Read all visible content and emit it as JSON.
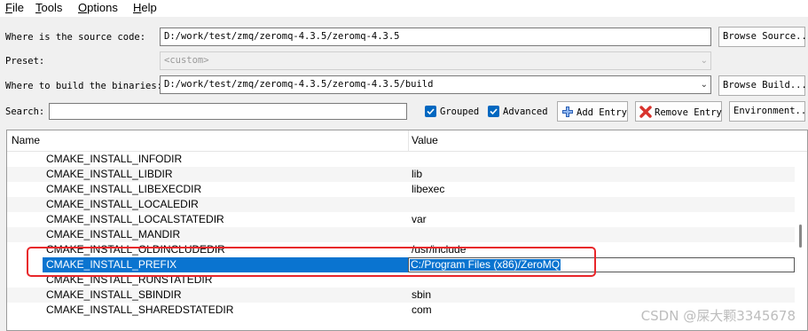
{
  "menubar": {
    "items": [
      {
        "label": "File",
        "mnemonic": "F",
        "rest": "ile"
      },
      {
        "label": "Tools",
        "mnemonic": "T",
        "rest": "ools"
      },
      {
        "label": "Options",
        "mnemonic": "O",
        "rest": "ptions"
      },
      {
        "label": "Help",
        "mnemonic": "H",
        "rest": "elp"
      }
    ]
  },
  "source": {
    "label": "Where is the source code:",
    "value": "D:/work/test/zmq/zeromq-4.3.5/zeromq-4.3.5",
    "browse_label": "Browse Source..."
  },
  "preset": {
    "label": "Preset:",
    "value": "<custom>"
  },
  "build": {
    "label": "Where to build the binaries:",
    "value": "D:/work/test/zmq/zeromq-4.3.5/zeromq-4.3.5/build",
    "browse_label": "Browse Build..."
  },
  "search": {
    "label": "Search:",
    "value": ""
  },
  "options": {
    "grouped_label": "Grouped",
    "grouped_checked": true,
    "advanced_label": "Advanced",
    "advanced_checked": true
  },
  "toolbar": {
    "add_entry_label": "Add Entry",
    "remove_entry_label": "Remove Entry",
    "environment_label": "Environment..."
  },
  "table": {
    "columns": [
      "Name",
      "Value"
    ],
    "rows": [
      {
        "name": "CMAKE_INSTALL_INFODIR",
        "value": ""
      },
      {
        "name": "CMAKE_INSTALL_LIBDIR",
        "value": "lib"
      },
      {
        "name": "CMAKE_INSTALL_LIBEXECDIR",
        "value": "libexec"
      },
      {
        "name": "CMAKE_INSTALL_LOCALEDIR",
        "value": ""
      },
      {
        "name": "CMAKE_INSTALL_LOCALSTATEDIR",
        "value": "var"
      },
      {
        "name": "CMAKE_INSTALL_MANDIR",
        "value": ""
      },
      {
        "name": "CMAKE_INSTALL_OLDINCLUDEDIR",
        "value": "/usr/include"
      },
      {
        "name": "CMAKE_INSTALL_PREFIX",
        "value": "C:/Program Files (x86)/ZeroMQ"
      },
      {
        "name": "CMAKE_INSTALL_RUNSTATEDIR",
        "value": ""
      },
      {
        "name": "CMAKE_INSTALL_SBINDIR",
        "value": "sbin"
      },
      {
        "name": "CMAKE_INSTALL_SHAREDSTATEDIR",
        "value": "com"
      }
    ],
    "selected_row": "CMAKE_INSTALL_PREFIX"
  },
  "colors": {
    "selection": "#0a74d0",
    "checkbox": "#0067c0",
    "highlight_box": "#e8262a"
  },
  "icons": {
    "add_entry": "plus-cross-icon",
    "remove_entry": "red-x-icon",
    "checkbox": "checkmark-icon"
  },
  "watermark": "CSDN @屎大颗3345678"
}
